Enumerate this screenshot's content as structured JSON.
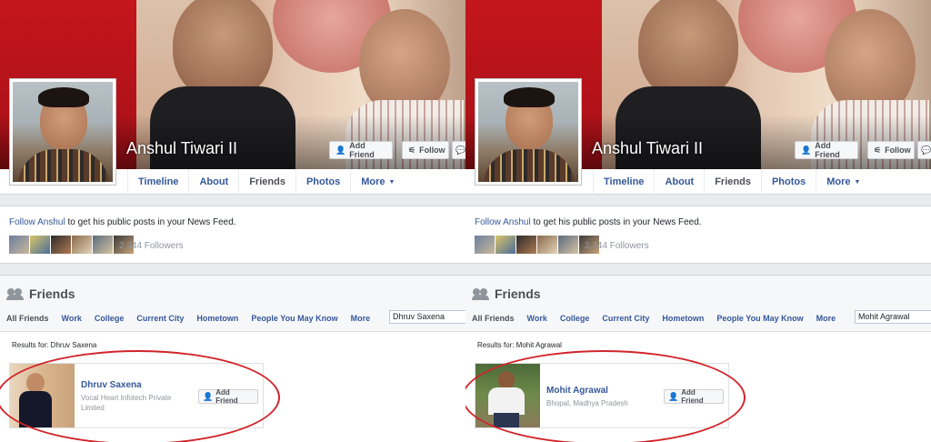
{
  "colors": {
    "link": "#365899",
    "annotation": "#d0252b",
    "background": "#e9ebee"
  },
  "panels": [
    {
      "profile_name": "Anshul Tiwari II",
      "buttons": {
        "add_friend": "Add Friend",
        "follow": "Follow"
      },
      "tabs": [
        "Timeline",
        "About",
        "Friends",
        "Photos",
        "More"
      ],
      "active_tab": "Friends",
      "follow_prompt": {
        "link": "Follow Anshul",
        "rest": " to get his public posts in your News Feed."
      },
      "followers": "2,344 Followers",
      "friends": {
        "title": "Friends",
        "tabs": [
          "All Friends",
          "Work",
          "College",
          "Current City",
          "Hometown",
          "People You May Know",
          "More"
        ],
        "search_value": "Dhruv Saxena",
        "results_label": "Results for: Dhruv Saxena",
        "result": {
          "name": "Dhruv Saxena",
          "subtitle": "Vocal Heart Infotech Private Limited",
          "button": "Add Friend"
        }
      }
    },
    {
      "profile_name": "Anshul Tiwari II",
      "buttons": {
        "add_friend": "Add Friend",
        "follow": "Follow"
      },
      "tabs": [
        "Timeline",
        "About",
        "Friends",
        "Photos",
        "More"
      ],
      "active_tab": "Friends",
      "follow_prompt": {
        "link": "Follow Anshul",
        "rest": " to get his public posts in your News Feed."
      },
      "followers": "2,344 Followers",
      "friends": {
        "title": "Friends",
        "tabs": [
          "All Friends",
          "Work",
          "College",
          "Current City",
          "Hometown",
          "People You May Know",
          "More"
        ],
        "search_value": "Mohit Agrawal",
        "results_label": "Results for: Mohit Agrawal",
        "result": {
          "name": "Mohit Agrawal",
          "subtitle": "Bhopal, Madhya Pradesh",
          "button": "Add Friend"
        }
      }
    }
  ]
}
